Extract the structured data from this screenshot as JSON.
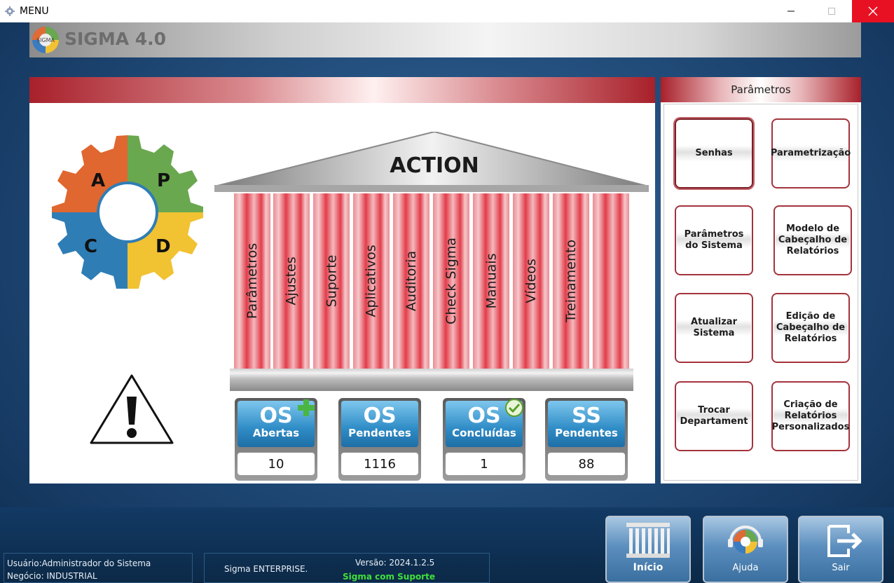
{
  "window": {
    "title": "MENU"
  },
  "brand": {
    "name": "SIGMA 4.0",
    "logo_text": "SIGMA"
  },
  "apcd": {
    "a": "A",
    "p": "P",
    "c": "C",
    "d": "D"
  },
  "temple": {
    "title": "ACTION",
    "columns": [
      "Parâmetros",
      "Ajustes",
      "Suporte",
      "Aplicativos",
      "Auditoria",
      "Check Sigma",
      "Manuais",
      "Vídeos",
      "Treinamento",
      ""
    ]
  },
  "counters": [
    {
      "os": "OS",
      "label": "Abertas",
      "value": "10",
      "badge": "plus-icon"
    },
    {
      "os": "OS",
      "label": "Pendentes",
      "value": "1116",
      "badge": ""
    },
    {
      "os": "OS",
      "label": "Concluídas",
      "value": "1",
      "badge": "check-icon"
    },
    {
      "os": "SS",
      "label": "Pendentes",
      "value": "88",
      "badge": ""
    }
  ],
  "parameters": {
    "title": "Parâmetros",
    "buttons": [
      "Senhas",
      "Parametrização",
      "Parâmetros do Sistema",
      "Modelo de Cabeçalho de Relatórios",
      "Atualizar Sistema",
      "Edição de Cabeçalho de Relatórios",
      "Trocar Departament",
      "Criação de Relatórios Personalizados"
    ]
  },
  "status": {
    "user": "Usuário:Administrador do Sistema",
    "business": "Negócio: INDUSTRIAL",
    "edition": "Sigma ENTERPRISE.",
    "version": "Versão: 2024.1.2.5",
    "support": "Sigma com Suporte"
  },
  "nav": {
    "home": "Início",
    "help": "Ajuda",
    "exit": "Sair"
  },
  "colors": {
    "accent_red": "#a8202a",
    "support_green": "#3fe03b",
    "close_red": "#e81123"
  }
}
